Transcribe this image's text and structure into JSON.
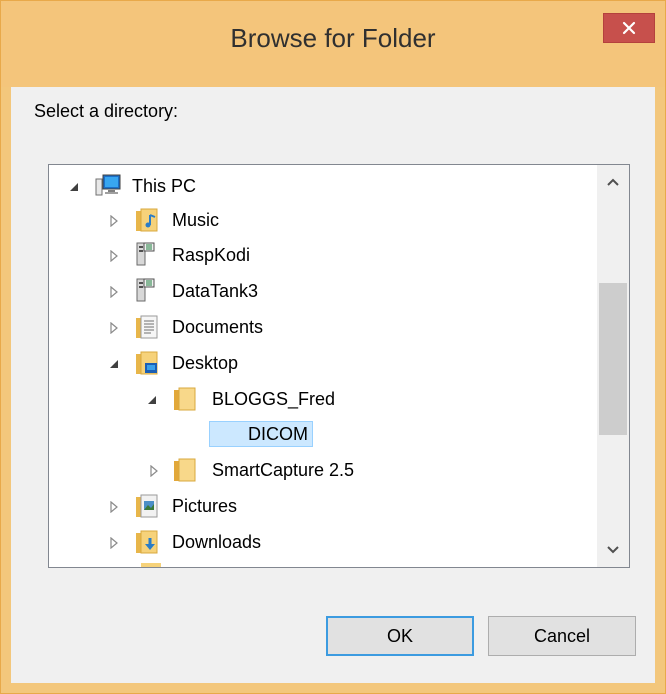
{
  "window": {
    "title": "Browse for Folder",
    "close_icon": "close-x-icon"
  },
  "prompt": "Select a directory:",
  "tree": {
    "items": [
      {
        "label": "This PC",
        "icon": "computer-icon",
        "expanded": true
      },
      {
        "label": "Music",
        "icon": "music-folder-icon",
        "expanded": false
      },
      {
        "label": "RaspKodi",
        "icon": "network-drive-icon",
        "expanded": false
      },
      {
        "label": "DataTank3",
        "icon": "network-drive-icon",
        "expanded": false
      },
      {
        "label": "Documents",
        "icon": "documents-folder-icon",
        "expanded": false
      },
      {
        "label": "Desktop",
        "icon": "desktop-folder-icon",
        "expanded": true
      },
      {
        "label": "BLOGGS_Fred",
        "icon": "folder-icon",
        "expanded": true
      },
      {
        "label": "DICOM",
        "icon": "folder-icon",
        "selected": true
      },
      {
        "label": "SmartCapture 2.5",
        "icon": "folder-icon",
        "expanded": false
      },
      {
        "label": "Pictures",
        "icon": "pictures-folder-icon",
        "expanded": false
      },
      {
        "label": "Downloads",
        "icon": "downloads-folder-icon",
        "expanded": false
      }
    ]
  },
  "buttons": {
    "ok": "OK",
    "cancel": "Cancel"
  },
  "colors": {
    "titlebar": "#f4c57b",
    "close_button": "#c7504c",
    "selection": "#cce8ff",
    "default_button_border": "#3c9be0"
  }
}
